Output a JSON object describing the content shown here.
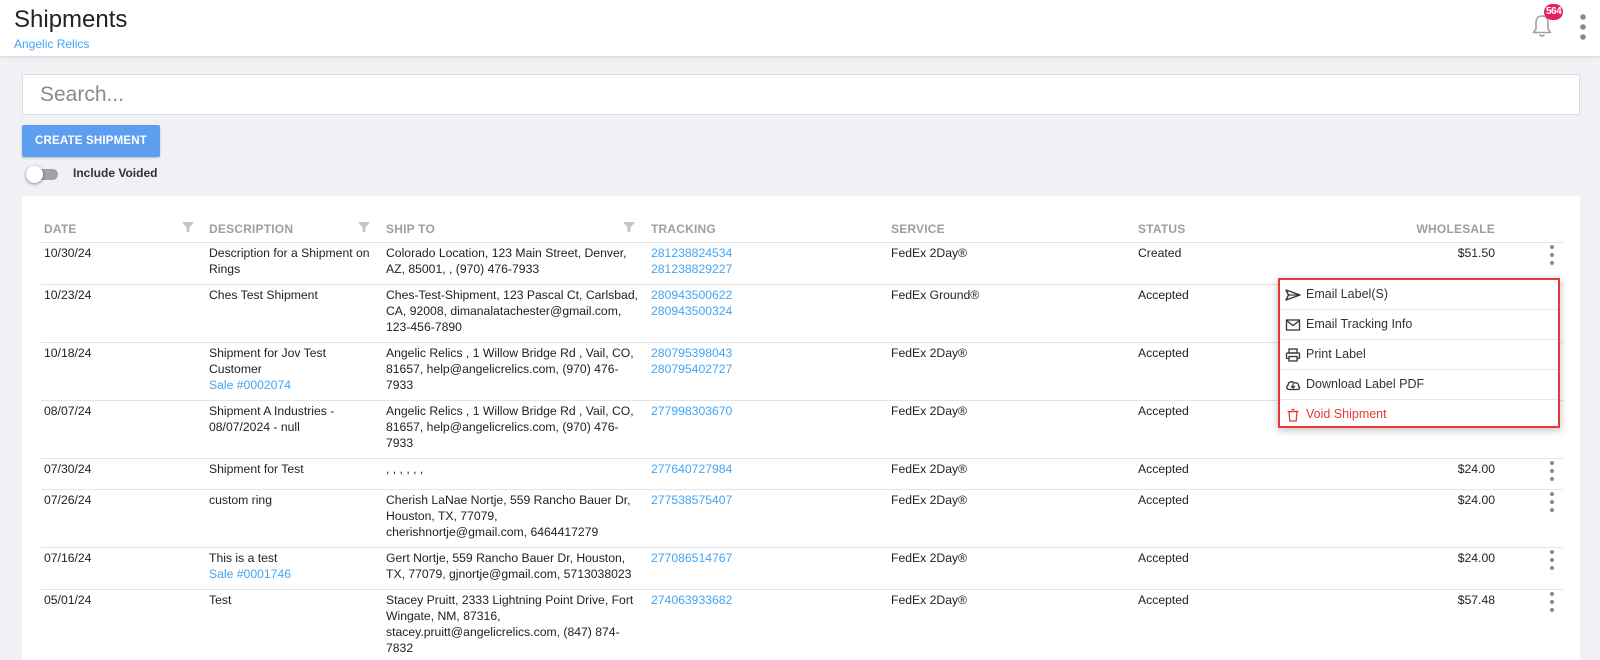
{
  "header": {
    "title": "Shipments",
    "subtitle": "Angelic Relics",
    "notification_count": "564"
  },
  "search": {
    "placeholder": "Search..."
  },
  "actions": {
    "create_label": "CREATE SHIPMENT",
    "toggle_label": "Include Voided",
    "include_voided": false
  },
  "table": {
    "columns": {
      "date": "DATE",
      "description": "DESCRIPTION",
      "ship_to": "SHIP TO",
      "tracking": "TRACKING",
      "service": "SERVICE",
      "status": "STATUS",
      "wholesale": "WHOLESALE"
    },
    "rows": [
      {
        "date": "10/30/24",
        "description": [
          "Description for a Shipment on",
          "Rings"
        ],
        "sale": "",
        "ship_to": [
          "Colorado Location, 123 Main Street, Denver,",
          "AZ, 85001, , (970) 476-7933"
        ],
        "tracking": [
          "281238824534",
          "281238829227"
        ],
        "service": "FedEx 2Day®",
        "status": "Created",
        "wholesale": "$51.50"
      },
      {
        "date": "10/23/24",
        "description": [
          "Ches Test Shipment"
        ],
        "sale": "",
        "ship_to": [
          "Ches-Test-Shipment, 123 Pascal Ct, Carlsbad,",
          "CA, 92008, dimanalatachester@gmail.com,",
          "123-456-7890"
        ],
        "tracking": [
          "280943500622",
          "280943500324"
        ],
        "service": "FedEx Ground®",
        "status": "Accepted",
        "wholesale": ""
      },
      {
        "date": "10/18/24",
        "description": [
          "Shipment for Jov Test",
          "Customer"
        ],
        "sale": "Sale #0002074",
        "ship_to": [
          "Angelic Relics , 1 Willow Bridge Rd , Vail, CO,",
          "81657, help@angelicrelics.com, (970) 476-",
          "7933"
        ],
        "tracking": [
          "280795398043",
          "280795402727"
        ],
        "service": "FedEx 2Day®",
        "status": "Accepted",
        "wholesale": ""
      },
      {
        "date": "08/07/24",
        "description": [
          "Shipment A Industries -",
          "08/07/2024 - null"
        ],
        "sale": "",
        "ship_to": [
          "Angelic Relics , 1 Willow Bridge Rd , Vail, CO,",
          "81657, help@angelicrelics.com, (970) 476-",
          "7933"
        ],
        "tracking": [
          "277998303670"
        ],
        "service": "FedEx 2Day®",
        "status": "Accepted",
        "wholesale": ""
      },
      {
        "date": "07/30/24",
        "description": [
          "Shipment for Test"
        ],
        "sale": "",
        "ship_to": [
          ", , , , , ,"
        ],
        "tracking": [
          "277640727984"
        ],
        "service": "FedEx 2Day®",
        "status": "Accepted",
        "wholesale": "$24.00"
      },
      {
        "date": "07/26/24",
        "description": [
          "custom ring"
        ],
        "sale": "",
        "ship_to": [
          "Cherish LaNae Nortje, 559 Rancho Bauer Dr,",
          "Houston, TX, 77079,",
          "cherishnortje@gmail.com, 6464417279"
        ],
        "tracking": [
          "277538575407"
        ],
        "service": "FedEx 2Day®",
        "status": "Accepted",
        "wholesale": "$24.00"
      },
      {
        "date": "07/16/24",
        "description": [
          "This is a test"
        ],
        "sale": "Sale #0001746",
        "ship_to": [
          "Gert Nortje, 559 Rancho Bauer Dr, Houston,",
          "TX, 77079, gjnortje@gmail.com, 5713038023"
        ],
        "tracking": [
          "277086514767"
        ],
        "service": "FedEx 2Day®",
        "status": "Accepted",
        "wholesale": "$24.00"
      },
      {
        "date": "05/01/24",
        "description": [
          "Test"
        ],
        "sale": "",
        "ship_to": [
          "Stacey Pruitt, 2333 Lightning Point Drive, Fort",
          "Wingate, NM, 87316,",
          "stacey.pruitt@angelicrelics.com, (847) 874-",
          "7832"
        ],
        "tracking": [
          "274063933682"
        ],
        "service": "FedEx 2Day®",
        "status": "Accepted",
        "wholesale": "$57.48"
      }
    ]
  },
  "row_menu": {
    "items": [
      {
        "label": "Email Label(S)",
        "icon": "send-icon"
      },
      {
        "label": "Email Tracking Info",
        "icon": "mail-icon"
      },
      {
        "label": "Print Label",
        "icon": "printer-icon"
      },
      {
        "label": "Download Label PDF",
        "icon": "cloud-download-icon"
      },
      {
        "label": "Void Shipment",
        "icon": "trash-icon",
        "danger_color": "#e53935"
      }
    ]
  },
  "colors": {
    "accent": "#42a5f5",
    "button": "#5c9ef0",
    "badge": "#e91e63",
    "danger": "#e53935"
  }
}
